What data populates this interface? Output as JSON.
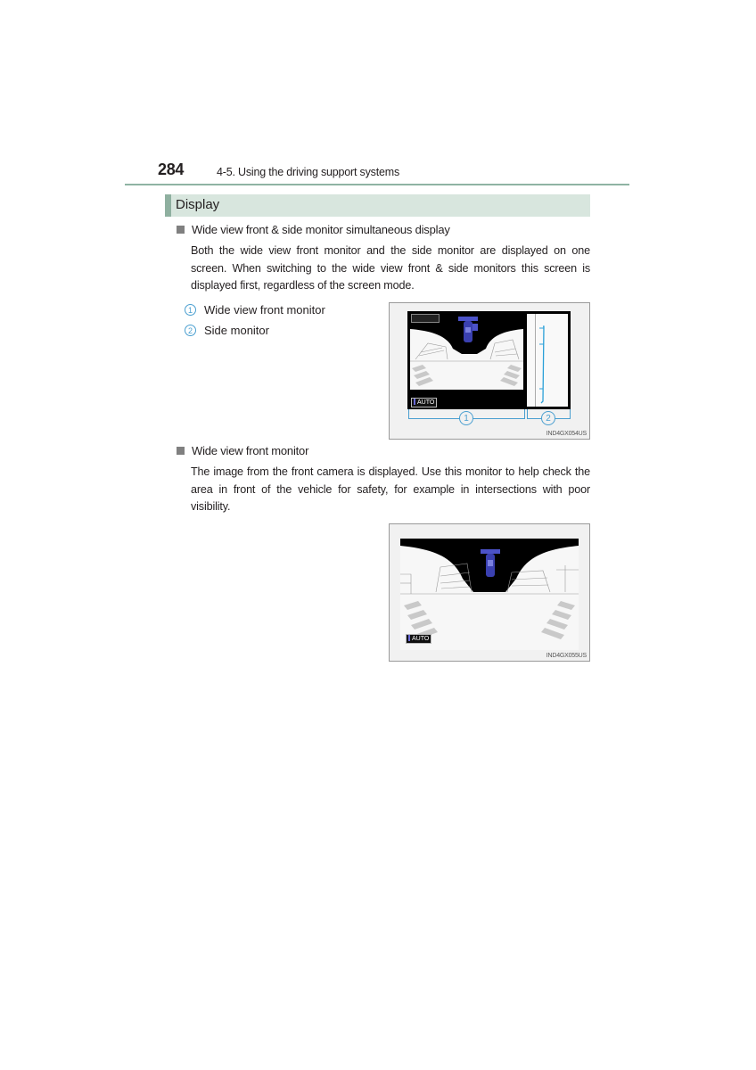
{
  "header": {
    "page_number": "284",
    "section_path": "4-5. Using the driving support systems"
  },
  "section": {
    "title": "Display"
  },
  "blocks": [
    {
      "heading": "Wide view front & side monitor simultaneous display",
      "body": "Both the wide view front monitor and the side monitor are displayed on one screen. When switching to the wide view front & side monitors this screen is displayed first, regardless of the screen mode.",
      "legend": [
        {
          "num": "1",
          "label": "Wide view front monitor"
        },
        {
          "num": "2",
          "label": "Side monitor"
        }
      ],
      "figure": {
        "code": "IND4GX054US",
        "auto_label": "AUTO",
        "callouts": [
          "1",
          "2"
        ],
        "icons": [
          "camera-mode-icon",
          "vehicle-top-view-icon",
          "side-guide-lines"
        ]
      }
    },
    {
      "heading": "Wide view front monitor",
      "body": "The image from the front camera is displayed. Use this monitor to help check the area in front of the vehicle for safety, for example in intersections with poor visibility.",
      "figure": {
        "code": "IND4GX055US",
        "auto_label": "AUTO",
        "icons": [
          "vehicle-top-view-icon"
        ]
      }
    }
  ],
  "colors": {
    "accent_green": "#8fb3a3",
    "section_bg": "#d8e6de",
    "callout_blue": "#4a9fd0",
    "vehicle_icon_blue": "#4b52c8"
  }
}
